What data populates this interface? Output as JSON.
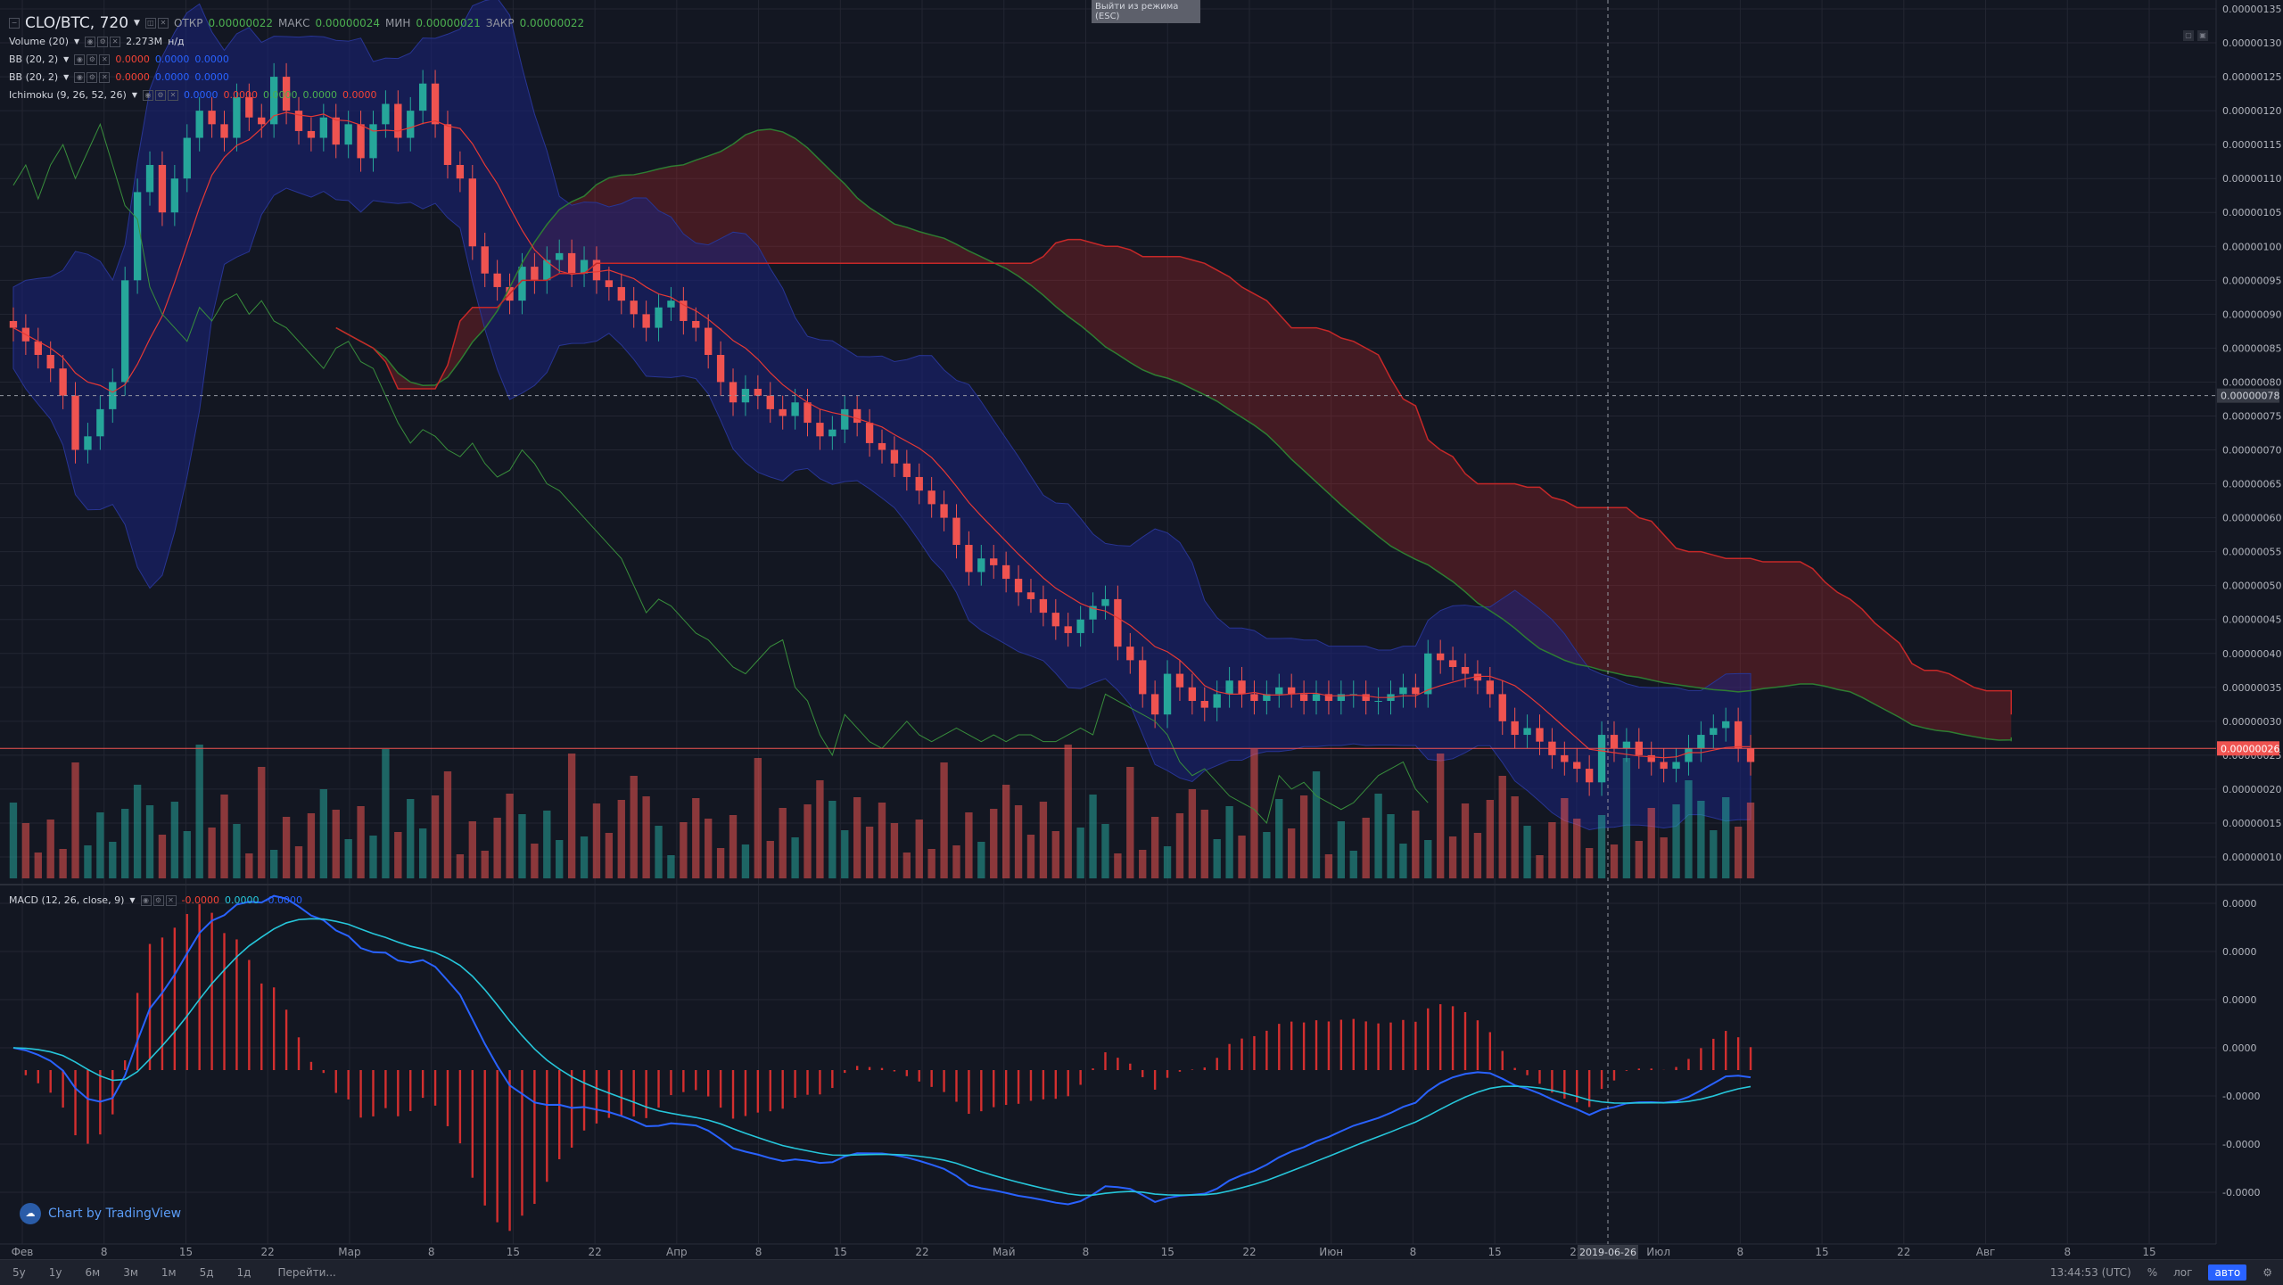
{
  "chart_data": {
    "type": "candlestick",
    "title": "CLO/BTC, 720",
    "symbol": "CLO/BTC",
    "interval": "720",
    "ohlc": {
      "open_label": "ОТКР",
      "open": "0.00000022",
      "high_label": "МАКС",
      "high": "0.00000024",
      "low_label": "МИН",
      "low": "0.00000021",
      "close_label": "ЗАКР",
      "close": "0.00000022"
    },
    "price_axis": {
      "ticks": [
        "0.00000135",
        "0.00000130",
        "0.00000125",
        "0.00000120",
        "0.00000115",
        "0.00000110",
        "0.00000105",
        "0.00000100",
        "0.00000095",
        "0.00000090",
        "0.00000085",
        "0.00000080",
        "0.00000075",
        "0.00000070",
        "0.00000065",
        "0.00000060",
        "0.00000055",
        "0.00000050",
        "0.00000045",
        "0.00000040",
        "0.00000035",
        "0.00000030",
        "0.00000025",
        "0.00000020",
        "0.00000015",
        "0.00000010"
      ],
      "crosshair_label": "0.00000078",
      "last_price_label": "0.00000026",
      "range": [
        9e-08,
        1.365e-06
      ]
    },
    "macd_axis": {
      "ticks": [
        "0.0000",
        "0.0000",
        "0.0000",
        "0.0000",
        "-0.0000",
        "-0.0000",
        "-0.0000"
      ]
    },
    "time_axis": {
      "ticks": [
        "Фев",
        "8",
        "15",
        "22",
        "Мар",
        "8",
        "15",
        "22",
        "Апр",
        "8",
        "15",
        "22",
        "Май",
        "8",
        "15",
        "22",
        "Июн",
        "8",
        "15",
        "22",
        "Июл",
        "8",
        "15",
        "22",
        "Авг",
        "8",
        "15"
      ],
      "crosshair_date": "2019-06-26"
    },
    "indicators": [
      {
        "name": "Volume (20)",
        "values": [
          "2.273M",
          "н/д"
        ]
      },
      {
        "name": "BB (20, 2)",
        "values": [
          "0.0000",
          "0.0000",
          "0.0000"
        ]
      },
      {
        "name": "BB (20, 2)",
        "values": [
          "0.0000",
          "0.0000",
          "0.0000"
        ]
      },
      {
        "name": "Ichimoku (9, 26, 52, 26)",
        "values": [
          "0.0000",
          "0.0000",
          "0.0000",
          "0.0000",
          "0.0000"
        ]
      },
      {
        "name": "MACD (12, 26, close, 9)",
        "values": [
          "-0.0000",
          "0.0000",
          "-0.0000"
        ]
      }
    ],
    "close_series": [
      88,
      86,
      84,
      82,
      78,
      70,
      72,
      76,
      80,
      95,
      108,
      112,
      105,
      110,
      116,
      120,
      118,
      116,
      122,
      119,
      118,
      125,
      120,
      117,
      116,
      119,
      115,
      118,
      113,
      118,
      121,
      116,
      120,
      124,
      118,
      112,
      110,
      100,
      96,
      94,
      92,
      97,
      95,
      98,
      99,
      96,
      98,
      95,
      94,
      92,
      90,
      88,
      91,
      92,
      89,
      88,
      84,
      80,
      77,
      79,
      78,
      76,
      75,
      77,
      74,
      72,
      73,
      76,
      74,
      71,
      70,
      68,
      66,
      64,
      62,
      60,
      56,
      52,
      54,
      53,
      51,
      49,
      48,
      46,
      44,
      43,
      45,
      47,
      48,
      41,
      39,
      34,
      31,
      37,
      35,
      33,
      32,
      34,
      36,
      34,
      33,
      34,
      35,
      34,
      33,
      34,
      33,
      34,
      34,
      33,
      33,
      34,
      35,
      34,
      40,
      39,
      38,
      37,
      36,
      34,
      30,
      28,
      29,
      27,
      25,
      24,
      23,
      21,
      28,
      26,
      27,
      25,
      24,
      23,
      24,
      26,
      28,
      29,
      30,
      26,
      24
    ],
    "colors": {
      "up": "#26a69a",
      "down": "#ef5350",
      "cloud_bull": "#2e7d32",
      "cloud_bear": "#c62828",
      "bollinger_fill": "#1a237e",
      "macd_line": "#2962ff",
      "signal_line": "#26c6da",
      "histogram": "#d32f2f",
      "background": "#131722",
      "grid": "#2a2e39"
    }
  },
  "overlays": {
    "esc_tip": "Выйти из режима (ESC)",
    "branding": "Chart by TradingView"
  },
  "bottom_bar": {
    "timeframes": [
      "5у",
      "1у",
      "6м",
      "3м",
      "1м",
      "5д",
      "1д"
    ],
    "goto_label": "Перейти...",
    "clock": "13:44:53 (UTC)",
    "percent": "%",
    "log": "лог",
    "auto": "авто"
  },
  "icons": {
    "settings": "gear-icon",
    "cloud_logo": "tradingview-cloud-icon"
  }
}
